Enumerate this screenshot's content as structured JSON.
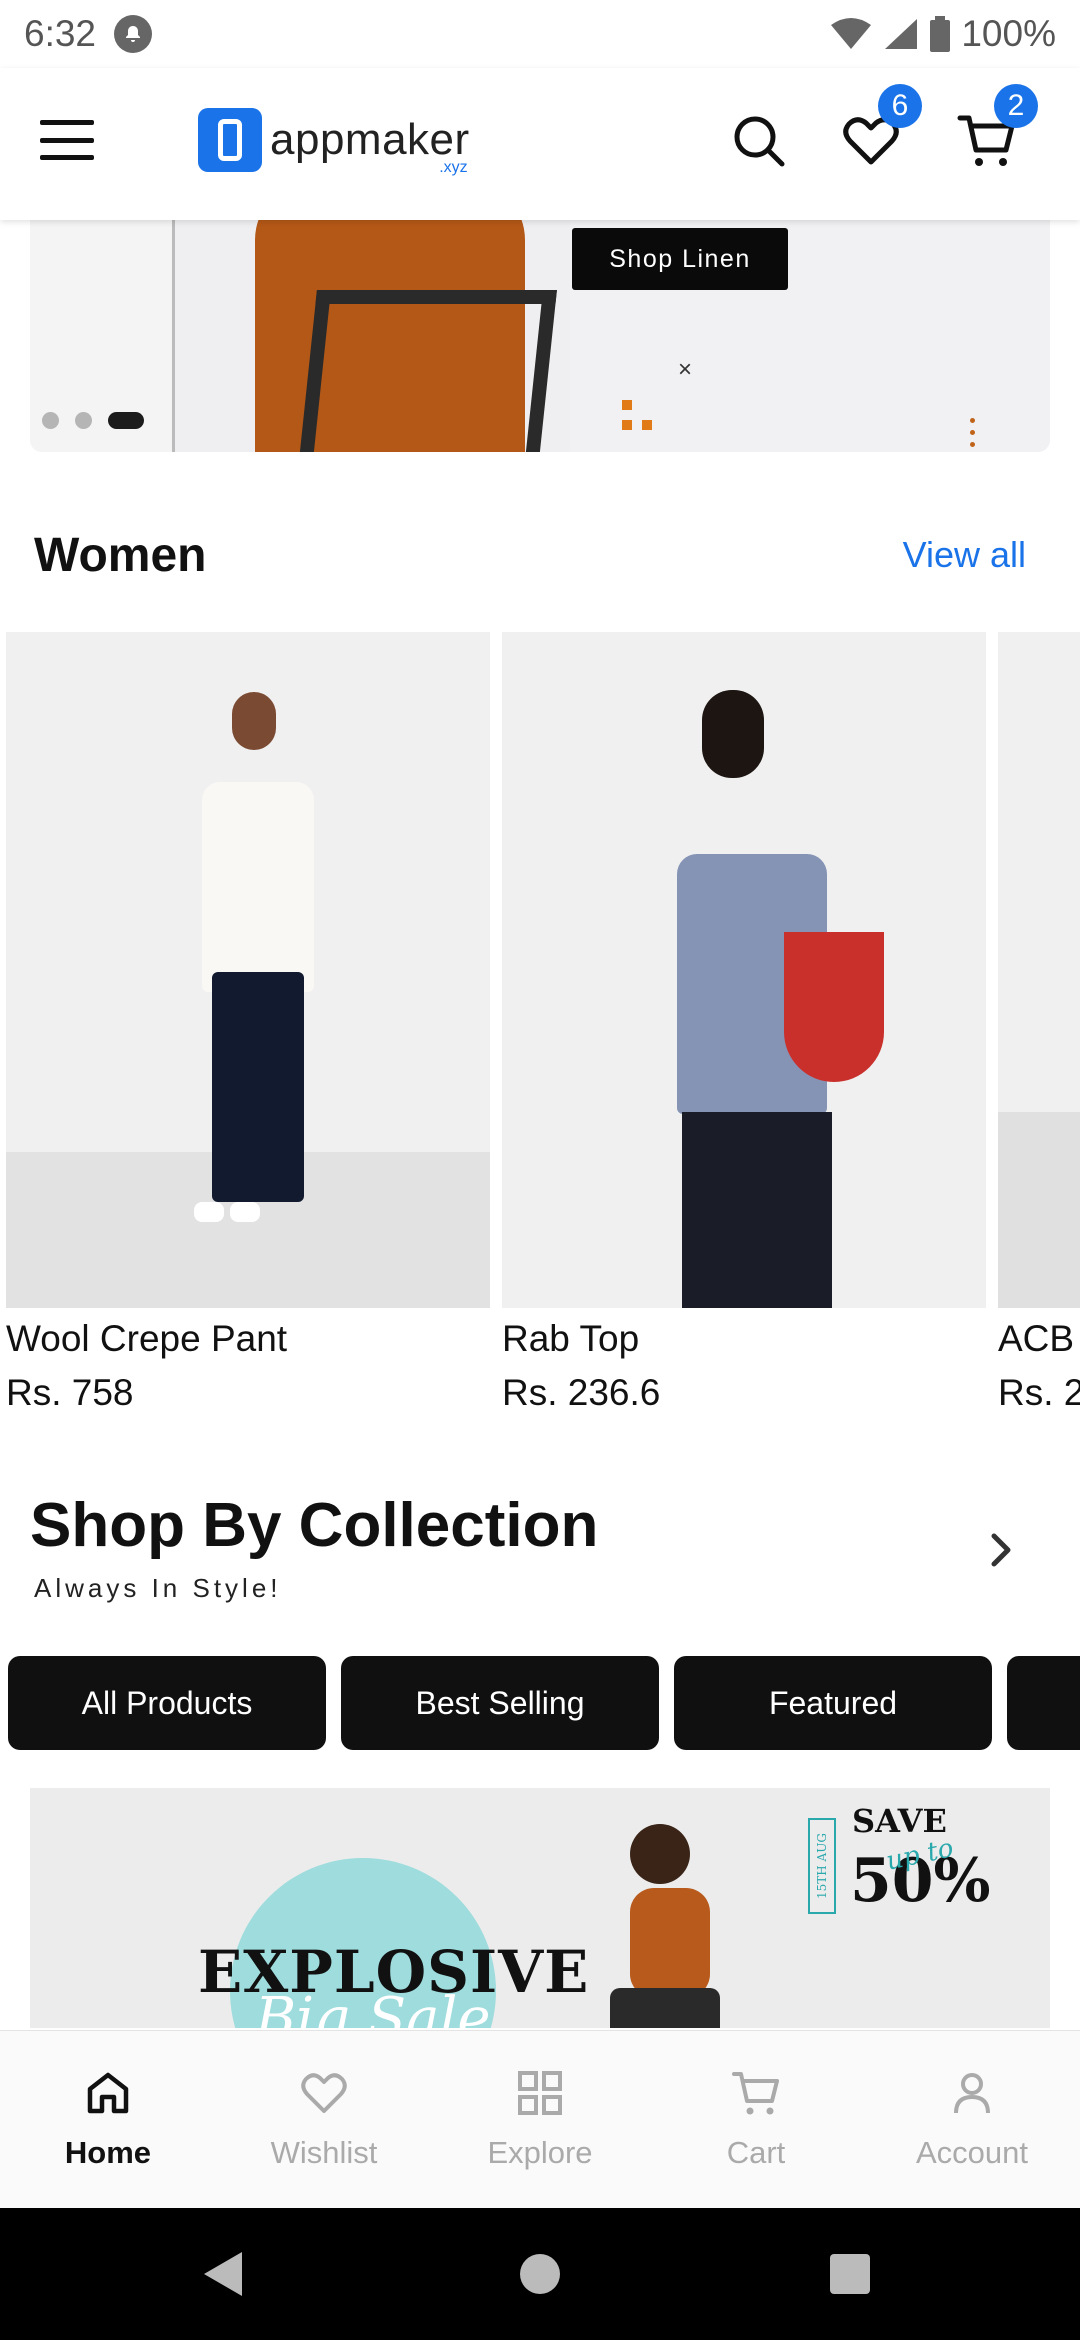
{
  "status_bar": {
    "time": "6:32",
    "battery": "100%"
  },
  "header": {
    "logo_word": "appmaker",
    "logo_sub": ".xyz",
    "wishlist_badge": "6",
    "cart_badge": "2"
  },
  "banner": {
    "button_label": "Shop Linen",
    "slide_count": 3,
    "active_slide": 3
  },
  "women_section": {
    "title": "Women",
    "view_all": "View all",
    "products": [
      {
        "name": "Wool Crepe Pant",
        "price": "Rs. 758"
      },
      {
        "name": "Rab Top",
        "price": "Rs. 236.6"
      },
      {
        "name": "ACB",
        "price": "Rs. 2"
      }
    ]
  },
  "collection_section": {
    "title": "Shop By Collection",
    "subtitle": "Always In Style!",
    "chips": [
      "All Products",
      "Best Selling",
      "Featured",
      ""
    ]
  },
  "sale_banner": {
    "headline": "EXPLOSIVE",
    "script": "Big Sale",
    "date": "15TH AUG",
    "save": "SAVE",
    "upto": "up to",
    "percent": "50%"
  },
  "bottom_nav": [
    {
      "label": "Home",
      "icon": "home-icon",
      "active": true
    },
    {
      "label": "Wishlist",
      "icon": "heart-icon",
      "active": false
    },
    {
      "label": "Explore",
      "icon": "grid-icon",
      "active": false
    },
    {
      "label": "Cart",
      "icon": "cart-icon",
      "active": false
    },
    {
      "label": "Account",
      "icon": "user-icon",
      "active": false
    }
  ],
  "colors": {
    "accent": "#1a73e8",
    "chip_bg": "#101010",
    "nav_active": "#111111",
    "nav_inactive": "#aaaaaa"
  }
}
